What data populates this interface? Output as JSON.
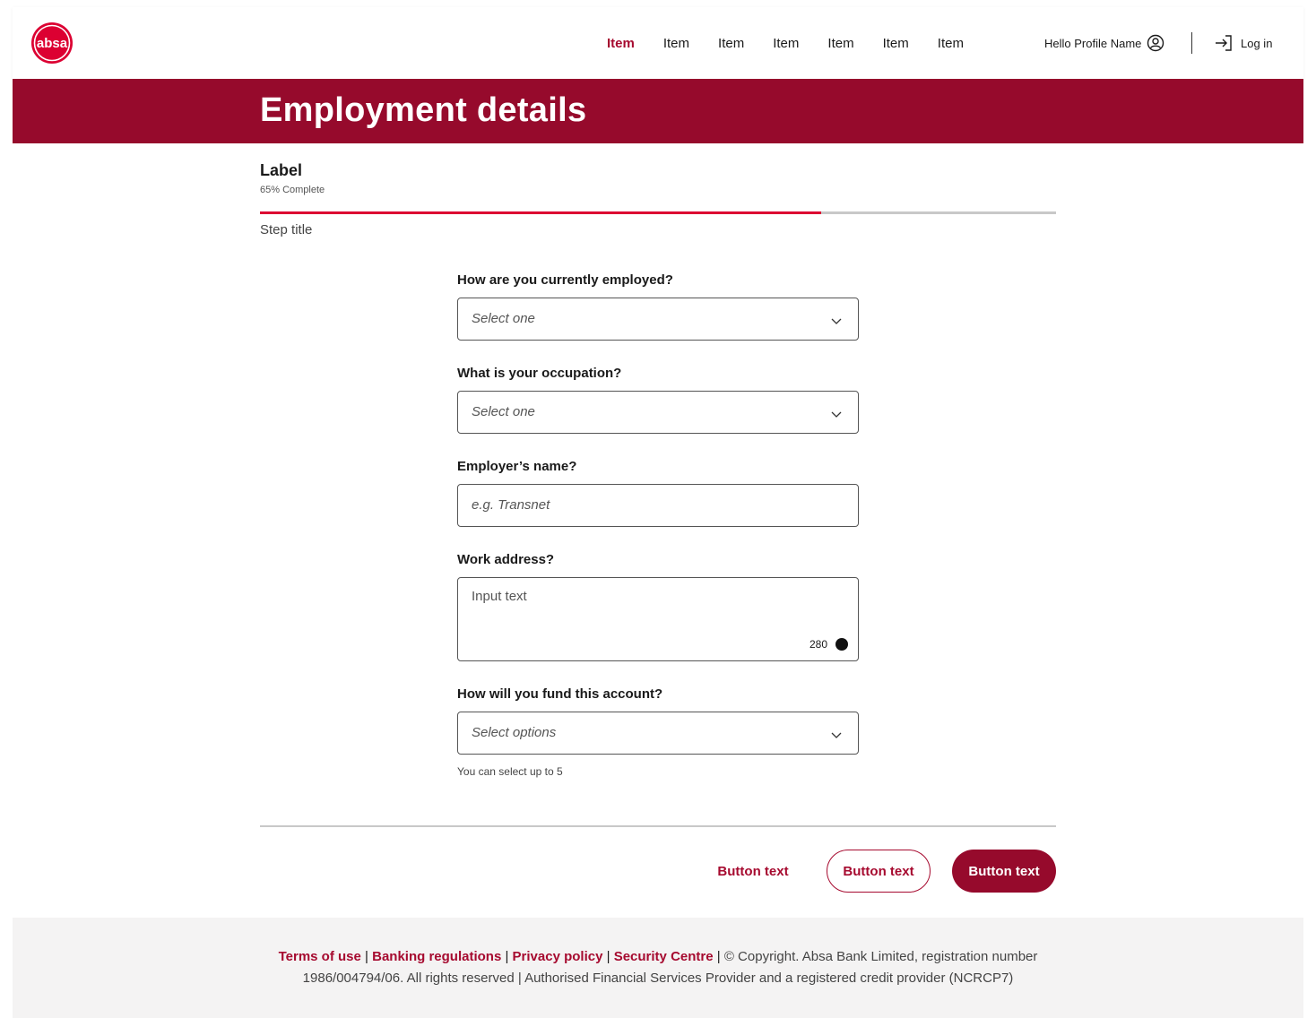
{
  "header": {
    "logo_text": "absa",
    "nav": [
      "Item",
      "Item",
      "Item",
      "Item",
      "Item",
      "Item",
      "Item"
    ],
    "active_index": 0,
    "profile_label": "Hello Profile Name",
    "login_label": "Log in"
  },
  "banner": {
    "title": "Employment details"
  },
  "progress": {
    "label": "Label",
    "percent_text": "65% Complete",
    "percent": 0.705,
    "step_title": "Step title"
  },
  "form": {
    "employment": {
      "label": "How are you currently employed?",
      "placeholder": "Select one"
    },
    "occupation": {
      "label": "What is your occupation?",
      "placeholder": "Select one"
    },
    "employer": {
      "label": "Employer’s name?",
      "placeholder": "e.g. Transnet"
    },
    "address": {
      "label": "Work address?",
      "placeholder": "Input text",
      "counter": "280"
    },
    "funding": {
      "label": "How will you fund this account?",
      "placeholder": "Select options",
      "helper": "You can select up to 5"
    }
  },
  "actions": {
    "text_button": "Button text",
    "outline_button": "Button text",
    "primary_button": "Button text"
  },
  "footer": {
    "links": [
      "Terms of use",
      "Banking regulations",
      "Privacy policy",
      "Security Centre"
    ],
    "copyright_1": "© Copyright. Absa Bank Limited, registration number",
    "copyright_2": "1986/004794/06. All rights reserved | Authorised Financial Services Provider and a registered credit provider (NCRCP7)"
  },
  "colors": {
    "brand": "#960a2c",
    "accent": "#dc0032",
    "link": "#a60a2f"
  }
}
